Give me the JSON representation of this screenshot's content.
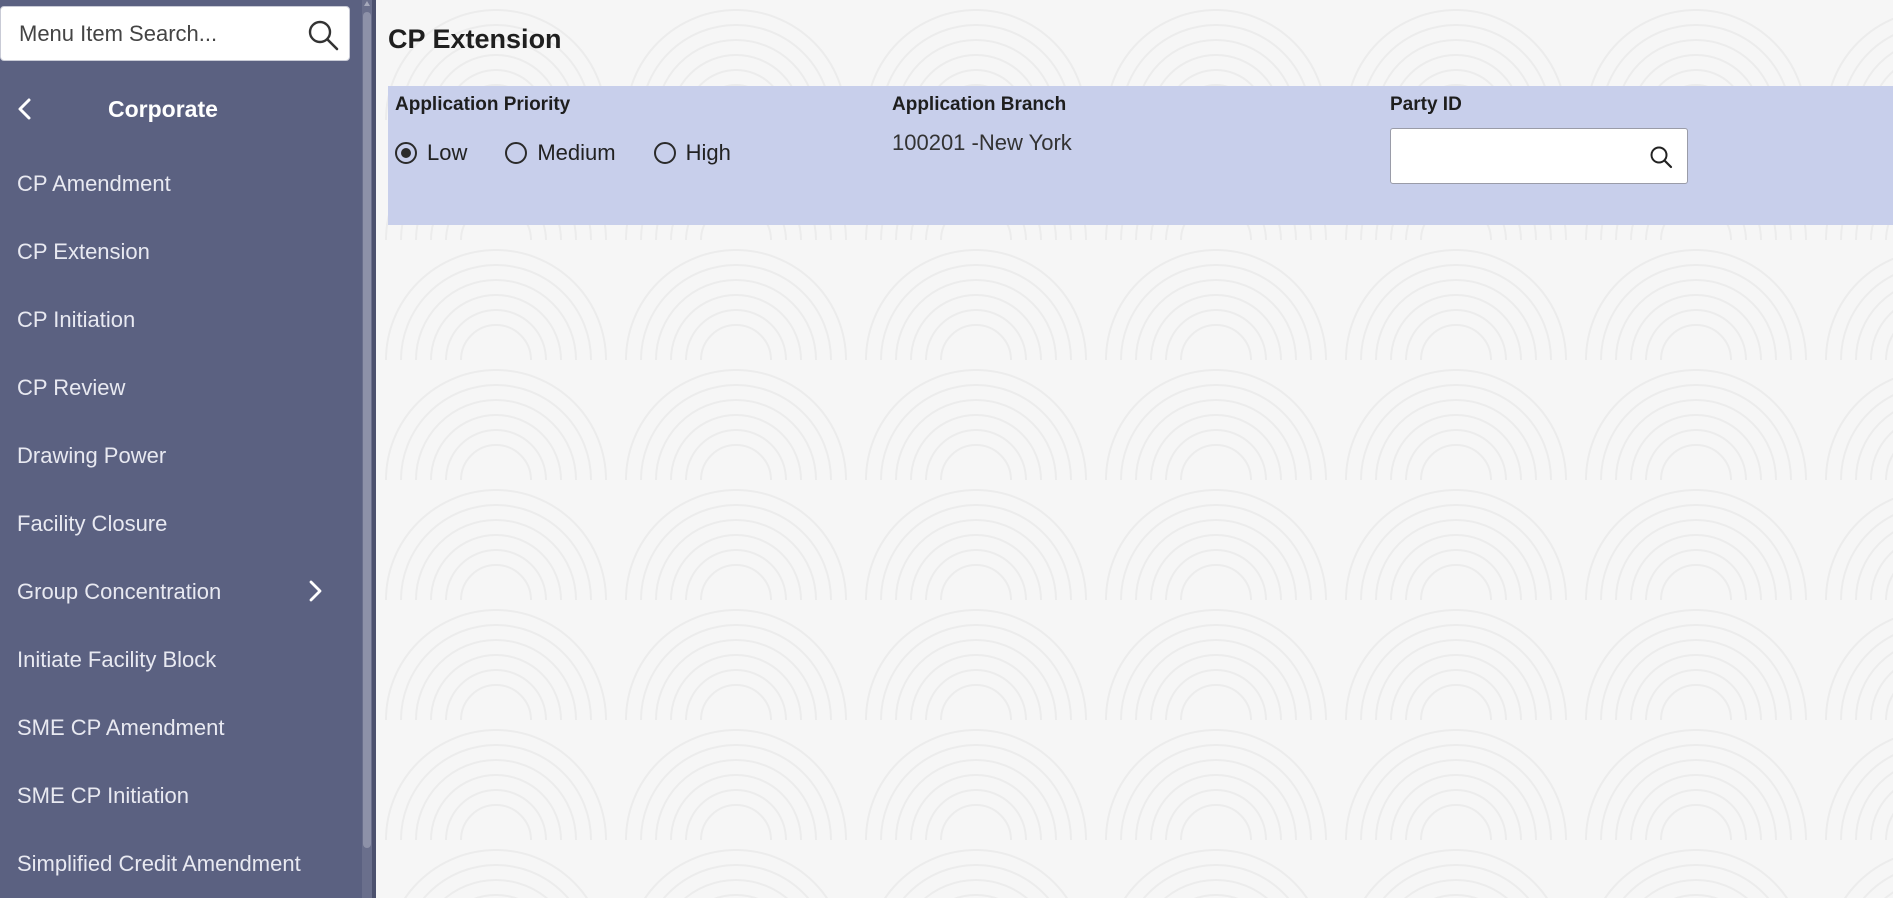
{
  "sidebar": {
    "search_placeholder": "Menu Item Search...",
    "title": "Corporate",
    "items": [
      {
        "label": "CP Amendment",
        "has_submenu": false
      },
      {
        "label": "CP Extension",
        "has_submenu": false
      },
      {
        "label": "CP Initiation",
        "has_submenu": false
      },
      {
        "label": "CP Review",
        "has_submenu": false
      },
      {
        "label": "Drawing Power",
        "has_submenu": false
      },
      {
        "label": "Facility Closure",
        "has_submenu": false
      },
      {
        "label": "Group Concentration",
        "has_submenu": true
      },
      {
        "label": "Initiate Facility Block",
        "has_submenu": false
      },
      {
        "label": "SME CP Amendment",
        "has_submenu": false
      },
      {
        "label": "SME CP Initiation",
        "has_submenu": false
      },
      {
        "label": "Simplified Credit Amendment",
        "has_submenu": false
      }
    ]
  },
  "main": {
    "title": "CP Extension",
    "application_priority": {
      "label": "Application Priority",
      "options": [
        "Low",
        "Medium",
        "High"
      ],
      "selected": "Low"
    },
    "application_branch": {
      "label": "Application Branch",
      "value": "100201 -New York"
    },
    "party_id": {
      "label": "Party ID",
      "value": ""
    }
  },
  "colors": {
    "sidebar_bg": "#5b6181",
    "panel_bg": "#c8cfeb",
    "page_bg": "#f6f6f6"
  },
  "icons": {
    "search": "search-icon",
    "back": "chevron-left-icon",
    "submenu": "chevron-right-icon",
    "party_lookup": "search-icon"
  }
}
